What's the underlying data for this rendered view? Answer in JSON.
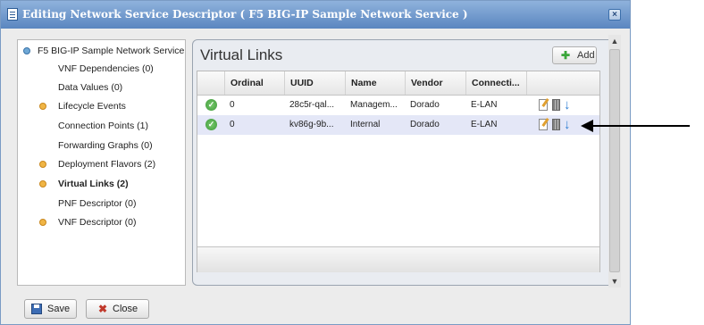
{
  "window": {
    "title": "Editing Network Service Descriptor ( F5 BIG-IP Sample Network Service )",
    "close_label": "×"
  },
  "tree": {
    "root": "F5 BIG-IP Sample Network Service",
    "items": [
      {
        "label": "VNF Dependencies (0)"
      },
      {
        "label": "Data Values (0)"
      },
      {
        "label": "Lifecycle Events"
      },
      {
        "label": "Connection Points (1)"
      },
      {
        "label": "Forwarding Graphs (0)"
      },
      {
        "label": "Deployment Flavors (2)"
      },
      {
        "label": "Virtual Links (2)"
      },
      {
        "label": "PNF Descriptor (0)"
      },
      {
        "label": "VNF Descriptor (0)"
      }
    ]
  },
  "panel": {
    "title": "Virtual Links",
    "add_label": "Add",
    "columns": [
      "Ordinal",
      "UUID",
      "Name",
      "Vendor",
      "Connecti..."
    ],
    "rows": [
      {
        "ordinal": "0",
        "uuid": "28c5r-qal...",
        "name": "Managem...",
        "vendor": "Dorado",
        "connectivity": "E-LAN"
      },
      {
        "ordinal": "0",
        "uuid": "kv86g-9b...",
        "name": "Internal",
        "vendor": "Dorado",
        "connectivity": "E-LAN"
      }
    ]
  },
  "footer": {
    "save_label": "Save",
    "close_label": "Close"
  }
}
